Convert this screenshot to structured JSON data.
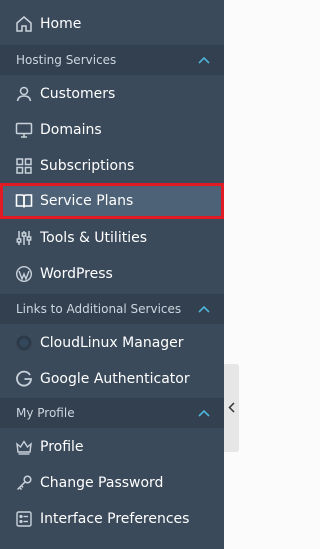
{
  "nav": {
    "home": {
      "label": "Home",
      "icon": "home-icon"
    },
    "hosting_section": {
      "label": "Hosting Services"
    },
    "customers": {
      "label": "Customers",
      "icon": "user-icon"
    },
    "domains": {
      "label": "Domains",
      "icon": "monitor-icon"
    },
    "subscriptions": {
      "label": "Subscriptions",
      "icon": "grid-icon"
    },
    "service_plans": {
      "label": "Service Plans",
      "icon": "book-icon",
      "selected": true
    },
    "tools": {
      "label": "Tools & Utilities",
      "icon": "sliders-icon"
    },
    "wordpress": {
      "label": "WordPress",
      "icon": "wordpress-icon"
    },
    "links_section": {
      "label": "Links to Additional Services"
    },
    "cloudlinux": {
      "label": "CloudLinux Manager",
      "icon": "cloudlinux-icon"
    },
    "google_auth": {
      "label": "Google Authenticator",
      "icon": "google-icon"
    },
    "profile_section": {
      "label": "My Profile"
    },
    "profile": {
      "label": "Profile",
      "icon": "crown-icon"
    },
    "change_password": {
      "label": "Change Password",
      "icon": "key-icon"
    },
    "interface_prefs": {
      "label": "Interface Preferences",
      "icon": "preferences-icon"
    }
  },
  "colors": {
    "sidebar_bg": "#3b4a5b",
    "section_bg": "#33404f",
    "selected_bg": "#4d6276",
    "highlight_border": "#e01b24",
    "accent": "#4fb3d9"
  }
}
